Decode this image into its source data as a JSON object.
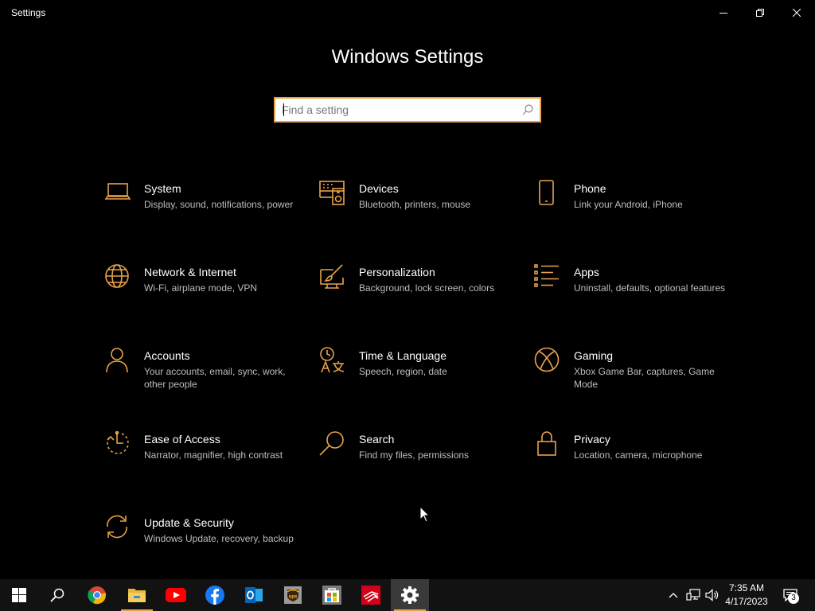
{
  "window": {
    "title": "Settings"
  },
  "header": {
    "title": "Windows Settings"
  },
  "search": {
    "placeholder": "Find a setting",
    "value": ""
  },
  "colors": {
    "accent": "#E8A24A",
    "background": "#000000",
    "description_text": "#BDBDBD",
    "taskbar": "#121212"
  },
  "categories": [
    {
      "title": "System",
      "description": "Display, sound, notifications, power",
      "icon": "laptop-icon"
    },
    {
      "title": "Devices",
      "description": "Bluetooth, printers, mouse",
      "icon": "keyboard-speaker-icon"
    },
    {
      "title": "Phone",
      "description": "Link your Android, iPhone",
      "icon": "phone-icon"
    },
    {
      "title": "Network & Internet",
      "description": "Wi-Fi, airplane mode, VPN",
      "icon": "globe-icon"
    },
    {
      "title": "Personalization",
      "description": "Background, lock screen, colors",
      "icon": "paint-brush-icon"
    },
    {
      "title": "Apps",
      "description": "Uninstall, defaults, optional features",
      "icon": "apps-list-icon"
    },
    {
      "title": "Accounts",
      "description": "Your accounts, email, sync, work, other people",
      "icon": "person-icon"
    },
    {
      "title": "Time & Language",
      "description": "Speech, region, date",
      "icon": "time-language-icon"
    },
    {
      "title": "Gaming",
      "description": "Xbox Game Bar, captures, Game Mode",
      "icon": "xbox-icon"
    },
    {
      "title": "Ease of Access",
      "description": "Narrator, magnifier, high contrast",
      "icon": "ease-of-access-icon"
    },
    {
      "title": "Search",
      "description": "Find my files, permissions",
      "icon": "magnifier-icon"
    },
    {
      "title": "Privacy",
      "description": "Location, camera, microphone",
      "icon": "lock-icon"
    },
    {
      "title": "Update & Security",
      "description": "Windows Update, recovery, backup",
      "icon": "sync-arrows-icon"
    }
  ],
  "taskbar": {
    "apps": [
      {
        "name": "start-button",
        "icon": "windows-logo-icon"
      },
      {
        "name": "search-button",
        "icon": "search-icon"
      },
      {
        "name": "chrome-app",
        "icon": "chrome-icon"
      },
      {
        "name": "file-explorer-app",
        "icon": "folder-icon"
      },
      {
        "name": "youtube-app",
        "icon": "youtube-icon"
      },
      {
        "name": "facebook-app",
        "icon": "facebook-icon"
      },
      {
        "name": "outlook-app",
        "icon": "outlook-icon"
      },
      {
        "name": "ups-app",
        "icon": "ups-icon"
      },
      {
        "name": "microsoft-store-app",
        "icon": "store-icon"
      },
      {
        "name": "bank-of-america-app",
        "icon": "bank-icon"
      },
      {
        "name": "settings-app",
        "icon": "gear-icon"
      }
    ],
    "time": "7:35 AM",
    "date": "4/17/2023",
    "notifications_count": "3"
  }
}
